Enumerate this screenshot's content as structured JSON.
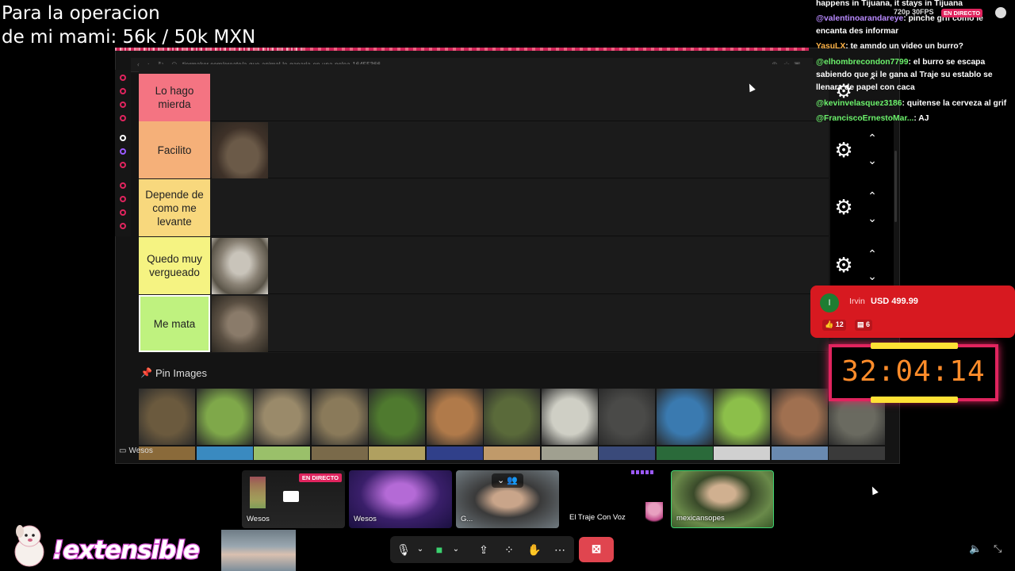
{
  "overlay": {
    "goal_line1": "Para la operacion",
    "goal_line2": "de mi mami: 56k / 50k MXN"
  },
  "browser": {
    "url": "tiermaker.com/create/a-que-animal-le-ganaria-en-una-pelea-16455366"
  },
  "tiers": [
    {
      "label": "Lo hago mierda",
      "color": "#f47482",
      "image": ""
    },
    {
      "label": "Facilito",
      "color": "#f5b079",
      "image": "platypus"
    },
    {
      "label": "Depende de como me levante",
      "color": "#f8d87d",
      "image": ""
    },
    {
      "label": "Quedo muy vergueado",
      "color": "#f5f382",
      "image": "wolf"
    },
    {
      "label": "Me mata",
      "color": "#bff27f",
      "image": "donkey"
    }
  ],
  "pin_images": {
    "title": "Pin Images",
    "row1": [
      "eagle",
      "cow",
      "goat",
      "hedgehog",
      "chicken",
      "guinea-pig",
      "crocodile",
      "sheep",
      "gorilla",
      "dolphin",
      "squirrel",
      "kangaroo",
      "owl"
    ],
    "row1_colors": [
      "#6b5a3e",
      "#7fa84a",
      "#9a8a6a",
      "#8a7a5a",
      "#4f7a2f",
      "#b07a4a",
      "#5a6a3a",
      "#cfcfc5",
      "#4a4a48",
      "#3a7ab0",
      "#8cbf4a",
      "#a07050",
      "#6a6a60"
    ],
    "row2_colors": [
      "#8a6a3a",
      "#3a8ac0",
      "#9ac06a",
      "#7a6a4a",
      "#b0a060",
      "#30408a",
      "#c09a6a",
      "#a0a090",
      "#3a4a7a",
      "#2a6a3a",
      "#d0d0d0",
      "#6a8ab0",
      "#3a3a3a"
    ]
  },
  "share_label": "Wesos",
  "controls": {
    "gear_count": 3
  },
  "chat": {
    "resolution": "720p 30FPS",
    "live_badge": "EN DIRECTO",
    "top_partial": "happens in Tijuana, it stays in Tijuana",
    "messages": [
      {
        "user": "@valentinoarandareye",
        "user_color": "#b98aff",
        "text": ": pinche grif como le encanta des informar"
      },
      {
        "user": "YasuLX",
        "user_color": "#ffb347",
        "text": ": te amndo un video un burro?"
      },
      {
        "user": "@elhombrecondon7799",
        "user_color": "#6cf26c",
        "text": ": el burro se escapa sabiendo que si le gana al Traje su establo se llenara de papel con caca"
      },
      {
        "user": "@kevinvelasquez3186",
        "user_color": "#6cf26c",
        "text": ": quitense la cerveza al grif"
      },
      {
        "user": "@FranciscoErnestoMar...",
        "user_color": "#6cf26c",
        "text": ": AJ"
      }
    ]
  },
  "superchat": {
    "initial": "I",
    "name": "Irvin",
    "amount": "USD 499.99",
    "likes": "12",
    "comments": "6"
  },
  "timer": {
    "value": "32:04:14"
  },
  "participants": [
    {
      "name": "Wesos",
      "live": "EN DIRECTO",
      "type": "screen"
    },
    {
      "name": "Wesos",
      "live": "",
      "type": "cam"
    },
    {
      "name": "G...",
      "live": "",
      "type": "cam"
    },
    {
      "name": "El Traje Con Voz",
      "live": "",
      "type": "avatar"
    },
    {
      "name": "mexicansopes",
      "live": "",
      "type": "cam"
    }
  ],
  "branding": {
    "name": "!extensible"
  },
  "toolbar": {
    "mic": "microphone-icon",
    "camera": "camera-icon",
    "share": "share-screen-icon",
    "apps": "apps-icon",
    "reactions": "reactions-icon",
    "more": "more-icon",
    "leave": "leave-icon"
  }
}
